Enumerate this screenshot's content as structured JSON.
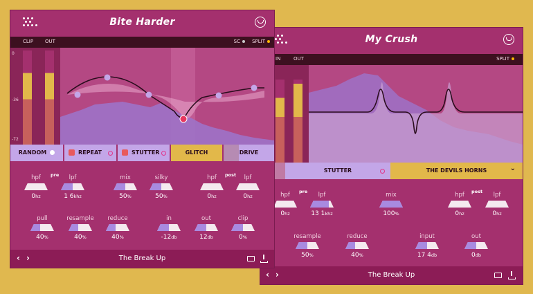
{
  "plugin1": {
    "title": "Bite Harder",
    "labels": {
      "sc": "SC",
      "split": "SPLIT",
      "clip": "CLIP",
      "out": "OUT"
    },
    "db_marks": [
      "0",
      "-36",
      "-72"
    ],
    "fx_tabs": [
      {
        "label": "RANDOM",
        "indicator": true
      },
      {
        "label": "REPEAT",
        "indicator": true,
        "warn": true
      },
      {
        "label": "STUTTER",
        "indicator": true,
        "warn": true
      },
      {
        "label": "GLITCH",
        "indicator": false
      },
      {
        "label": "DRIVE",
        "indicator": false
      }
    ],
    "tags": {
      "pre": "pre",
      "post": "post"
    },
    "controls": [
      {
        "label": "hpf",
        "value": "0",
        "unit": "hz",
        "fill": 0
      },
      {
        "label": "lpf",
        "value": "1 6",
        "unit": "khz",
        "fill": 0.5
      },
      {
        "label": "mix",
        "value": "50",
        "unit": "%",
        "fill": 0.5
      },
      {
        "label": "silky",
        "value": "50",
        "unit": "%",
        "fill": 0.5
      },
      {
        "label": "hpf",
        "value": "0",
        "unit": "hz",
        "fill": 0
      },
      {
        "label": "lpf",
        "value": "0",
        "unit": "hz",
        "fill": 0
      },
      {
        "label": "pull",
        "value": "40",
        "unit": "%",
        "fill": 0.4
      },
      {
        "label": "resample",
        "value": "40",
        "unit": "%",
        "fill": 0.4
      },
      {
        "label": "reduce",
        "value": "40",
        "unit": "%",
        "fill": 0.4
      },
      {
        "label": "in",
        "value": "-12",
        "unit": "db",
        "fill": 0.5
      },
      {
        "label": "out",
        "value": "12",
        "unit": "db",
        "fill": 0.5
      },
      {
        "label": "clip",
        "value": "0",
        "unit": "%",
        "fill": 0.5
      }
    ],
    "preset": "The Break Up",
    "nav": {
      "prev": "‹",
      "next": "›"
    }
  },
  "plugin2": {
    "title": "My Crush",
    "labels": {
      "split": "SPLIT",
      "in": "IN",
      "out": "OUT"
    },
    "fx_tabs": [
      {
        "label": "STUTTER",
        "indicator": true
      },
      {
        "label": "THE DEVILS HORNS",
        "dropdown": "⌄"
      }
    ],
    "tags": {
      "pre": "pre",
      "post": "post"
    },
    "controls": [
      {
        "label": "hpf",
        "value": "0",
        "unit": "hz",
        "fill": 0
      },
      {
        "label": "lpf",
        "value": "13 1",
        "unit": "khz",
        "fill": 0.8
      },
      {
        "label": "mix",
        "value": "100",
        "unit": "%",
        "fill": 1
      },
      {
        "label": "hpf",
        "value": "0",
        "unit": "hz",
        "fill": 0
      },
      {
        "label": "lpf",
        "value": "0",
        "unit": "hz",
        "fill": 0
      },
      {
        "label": "resample",
        "value": "50",
        "unit": "%",
        "fill": 0.5
      },
      {
        "label": "reduce",
        "value": "40",
        "unit": "%",
        "fill": 0.4
      },
      {
        "label": "input",
        "value": "17 4",
        "unit": "db",
        "fill": 0.5
      },
      {
        "label": "out",
        "value": "0",
        "unit": "db",
        "fill": 0.5
      }
    ],
    "preset": "The Break Up",
    "nav": {
      "prev": "‹",
      "next": "›"
    }
  },
  "colors": {
    "background": "#e0b84f",
    "panel": "#a4306e",
    "footer": "#8c1c56",
    "dark_bar": "#3d1020",
    "lavender": "#a88ae0",
    "gold": "#e2b84a"
  }
}
